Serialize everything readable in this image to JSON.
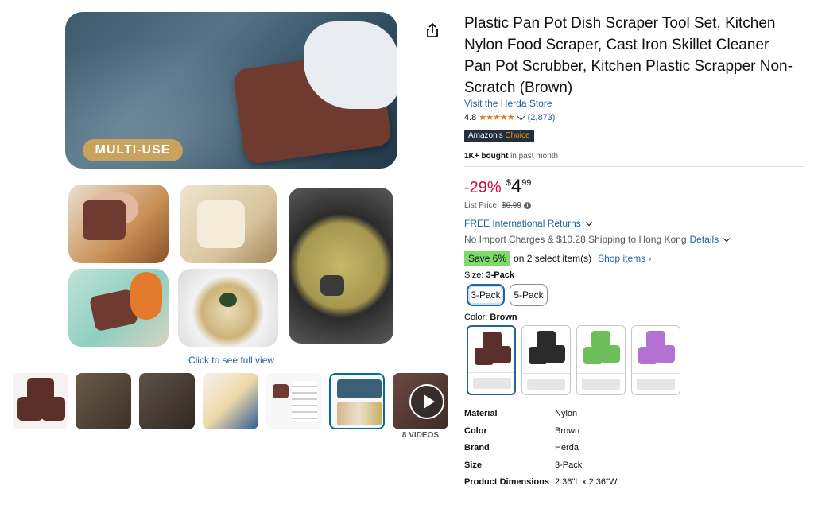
{
  "gallery": {
    "main_badge": "MULTI-USE",
    "full_view_link": "Click to see full view",
    "videos_label": "8 VIDEOS"
  },
  "product": {
    "title": "Plastic Pan Pot Dish Scraper Tool Set, Kitchen Nylon Food Scraper, Cast Iron Skillet Cleaner Pan Pot Scrubber, Kitchen Plastic Scrapper Non-Scratch (Brown)",
    "store_link": "Visit the Herda Store",
    "rating": "4.8",
    "stars": "★★★★★",
    "rating_count": "(2,873)",
    "choice_badge_prefix": "Amazon's",
    "choice_badge_suffix": "Choice",
    "bought_bold": "1K+ bought",
    "bought_rest": "in past month"
  },
  "pricing": {
    "discount": "-29%",
    "currency": "$",
    "whole": "4",
    "fraction": "99",
    "list_label": "List Price:",
    "list_value": "$6.99",
    "returns": "FREE International Returns",
    "shipping": "No Import Charges & $10.28 Shipping to Hong Kong",
    "shipping_details": "Details",
    "save_badge": "Save 6%",
    "save_text": "on 2 select item(s)",
    "shop_items": "Shop items ›"
  },
  "variants": {
    "size_label": "Size:",
    "size_value": "3-Pack",
    "sizes": [
      "3-Pack",
      "5-Pack"
    ],
    "color_label": "Color:",
    "color_value": "Brown",
    "swatch_colors": [
      "#5b302a",
      "#2b2b2b",
      "#6cbf5a",
      "#b371d1"
    ]
  },
  "specs": [
    {
      "key": "Material",
      "value": "Nylon"
    },
    {
      "key": "Color",
      "value": "Brown"
    },
    {
      "key": "Brand",
      "value": "Herda"
    },
    {
      "key": "Size",
      "value": "3-Pack"
    },
    {
      "key": "Product Dimensions",
      "value": "2.36\"L x 2.36\"W"
    }
  ]
}
